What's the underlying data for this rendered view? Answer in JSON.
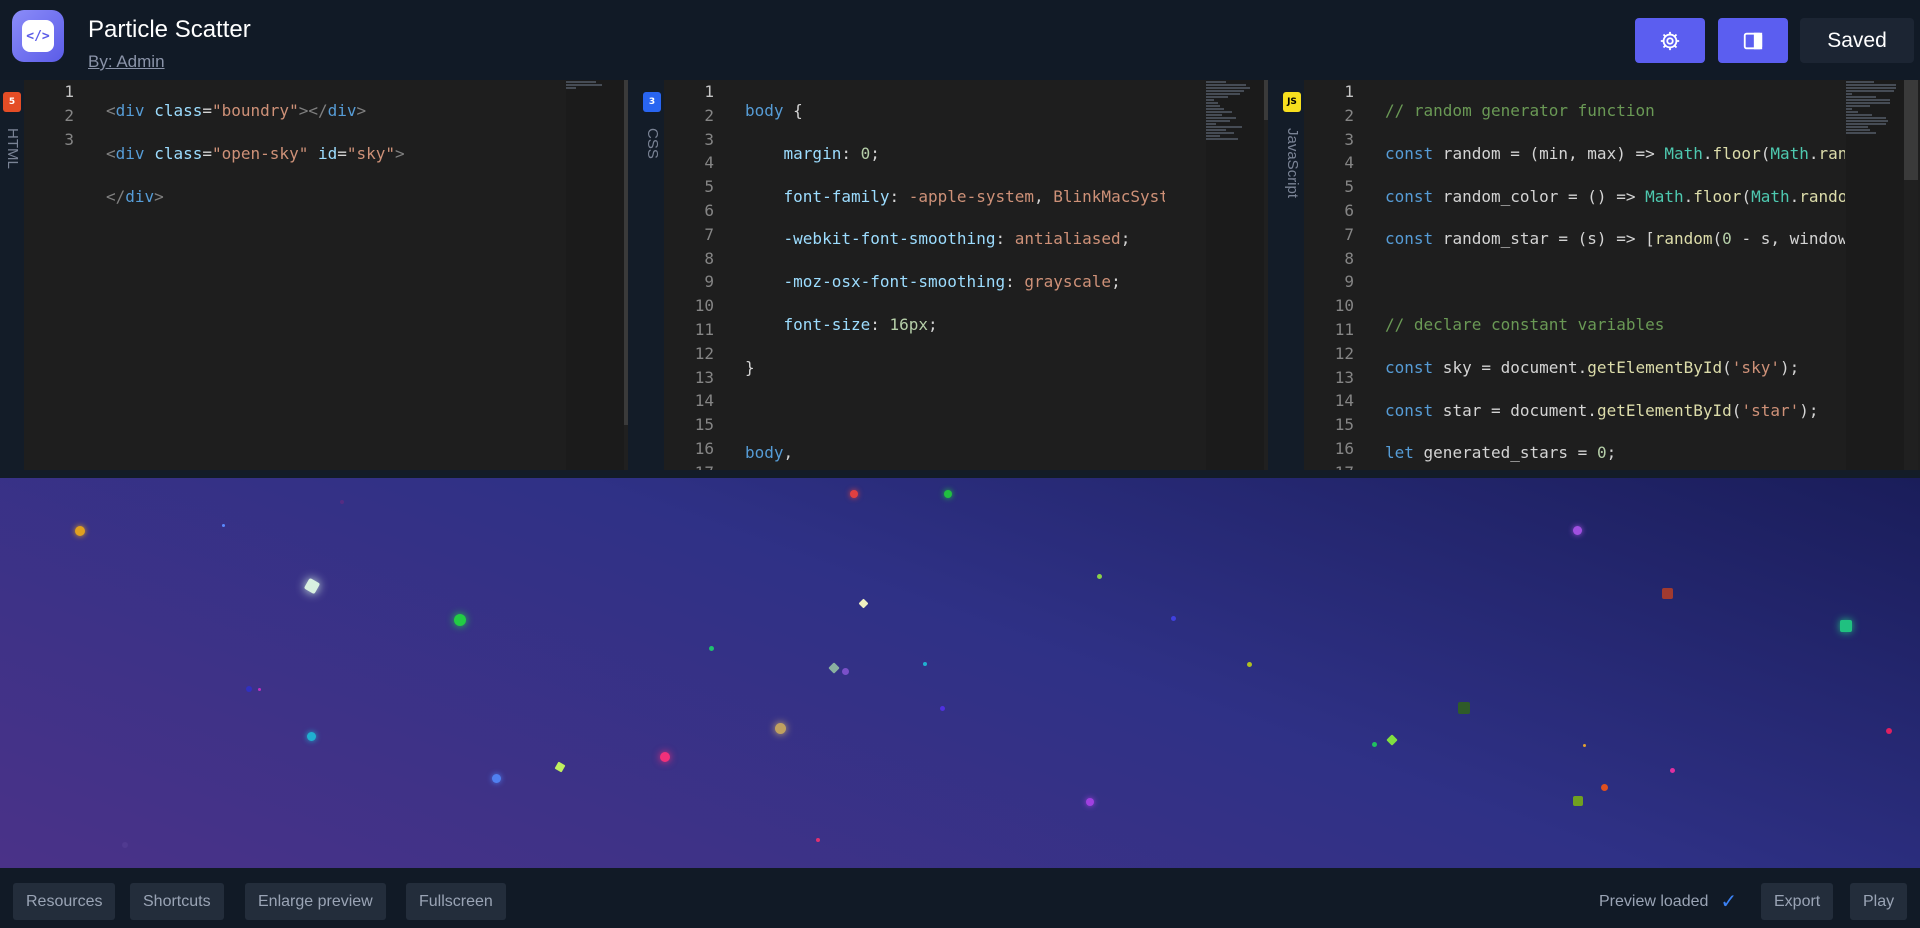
{
  "header": {
    "title": "Particle Scatter",
    "author": "By: Admin",
    "logo_icon": "code-icon",
    "logo_glyph": "</>",
    "settings_icon": "gear-icon",
    "layout_icon": "layout-icon",
    "saved_label": "Saved"
  },
  "panes": {
    "html": {
      "label": "HTML",
      "badge": "5",
      "badge_color": "#e44d26"
    },
    "css": {
      "label": "CSS",
      "badge": "3",
      "badge_color": "#2965f1"
    },
    "js": {
      "label": "JavaScript",
      "badge": "JS",
      "badge_color": "#f7df1e"
    }
  },
  "preview": {
    "bg_colors": [
      "#1a1d5a",
      "#2f3186",
      "#4a3288"
    ]
  },
  "footer": {
    "resources": "Resources",
    "shortcuts": "Shortcuts",
    "enlarge": "Enlarge preview",
    "fullscreen": "Fullscreen",
    "status": "Preview loaded",
    "export": "Export",
    "play": "Play"
  }
}
